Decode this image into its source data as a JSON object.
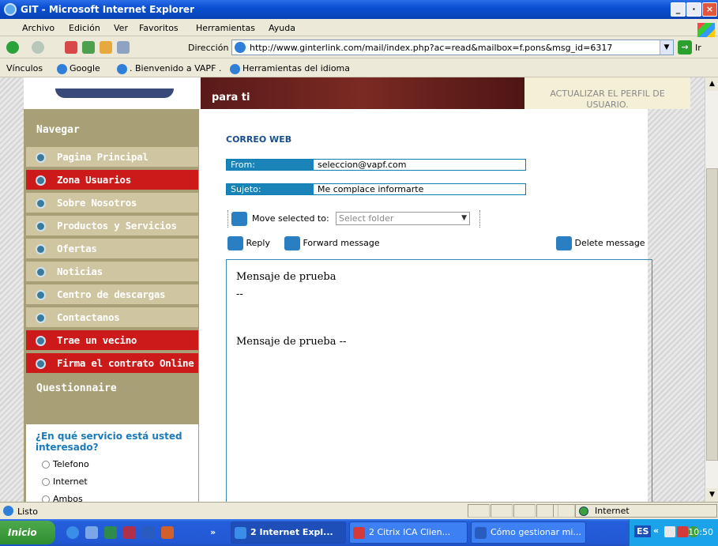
{
  "window": {
    "title": "GIT - Microsoft Internet Explorer",
    "min": "_",
    "max": "·",
    "close": "×"
  },
  "menu": [
    "Archivo",
    "Edición",
    "Ver",
    "Favoritos",
    "Herramientas",
    "Ayuda"
  ],
  "address": {
    "label": "Dirección",
    "url": "http://www.ginterlink.com/mail/index.php?ac=read&mailbox=f.pons&msg_id=6317",
    "go": "Ir"
  },
  "links": {
    "label": "Vínculos",
    "items": [
      "Google",
      ". Bienvenido a VAPF .",
      "Herramientas del idioma"
    ]
  },
  "page": {
    "banner_text": "para ti",
    "user_link_line1": "ACTUALIZAR EL PERFIL DE",
    "user_link_line2": "USUARIO.",
    "nav_title": "Navegar",
    "nav_items": [
      "Pagina Principal",
      "Zona Usuarios",
      "Sobre Nosotros",
      "Productos y Servicios",
      "Ofertas",
      "Noticias",
      "Centro de descargas",
      "Contactanos",
      "Trae un vecino",
      "Firma el contrato Online"
    ],
    "questionnaire_title": "Questionnaire",
    "question": "¿En qué servicio está usted interesado?",
    "options": [
      "Telefono",
      "Internet",
      "Ambos"
    ],
    "mail": {
      "heading": "CORREO WEB",
      "from_label": "From:",
      "from_value": "seleccion@vapf.com",
      "subject_label": "Sujeto:",
      "subject_value": "Me complace informarte",
      "move_label": "Move selected to:",
      "folder_placeholder": "Select folder",
      "reply": "Reply",
      "forward": "Forward message",
      "delete": "Delete message",
      "body_line1": "Mensaje de prueba",
      "body_line2": "--",
      "body_line3": "Mensaje de prueba --"
    }
  },
  "status": {
    "text": "Listo",
    "zone": "Internet"
  },
  "taskbar": {
    "start": "Inicio",
    "chevron": "»",
    "tasks": [
      "2 Internet Expl...",
      "2 Citrix ICA Clien...",
      "Cómo gestionar mi..."
    ],
    "lang": "ES",
    "time": "10:50"
  }
}
